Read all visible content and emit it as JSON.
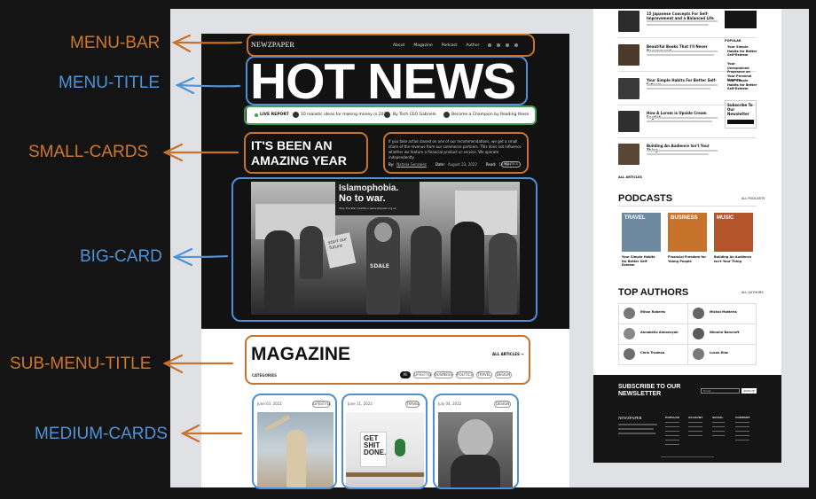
{
  "annotations": {
    "menu_bar": "MENU-BAR",
    "menu_title": "MENU-TITLE",
    "small_cards": "SMALL-CARDS",
    "big_card": "BIG-CARD",
    "sub_menu_title": "SUB-MENU-TITLE",
    "medium_cards": "MEDIUM-CARDS"
  },
  "colors": {
    "orange": "#c8732c",
    "blue": "#4f8fd6",
    "green": "#3fa04d"
  },
  "header": {
    "logo": "NEWZPAPER",
    "nav": [
      "About",
      "Magazine",
      "Podcast",
      "Author"
    ],
    "social_icons": [
      "facebook-icon",
      "twitter-icon",
      "instagram-icon",
      "youtube-icon"
    ]
  },
  "hero": {
    "title": "HOT NEWS",
    "ticker": {
      "live": "LIVE REPORT",
      "items": [
        "10 realistic ideas for making money in 2022",
        "By Tech CEO Gabriele",
        "Become a Champion by Reading these"
      ]
    },
    "card_title": "IT'S BEEN AN AMAZING YEAR",
    "card_desc": "If you take action based on one of our recommendations, we get a small share of the revenue from our commerce partners. This does not influence whether we feature a financial product or service. We operate independently.",
    "meta": {
      "by_label": "By:",
      "author": "Natalia Gonzalez",
      "date_label": "Date:",
      "date": "August 23, 2022",
      "read_label": "Read:",
      "read": "10 Min",
      "tag": "POLITICS"
    },
    "sign_line1": "Islamophobia.",
    "sign_line2": "No to war.",
    "sign_small": "Stop the War Coalition  www.stopwar.org.uk",
    "hoodie": "SDALE",
    "placard": "start our future"
  },
  "magazine": {
    "title": "MAGAZINE",
    "all_articles": "ALL ARTICLES",
    "categories_label": "CATEGORIES",
    "filters": [
      "All",
      "LIFESTYLE",
      "BUSINESS",
      "POLITICS",
      "TRAVEL",
      "DESIGN"
    ],
    "cards": [
      {
        "date": "June 03, 2022",
        "tag": "LIFESTYLE"
      },
      {
        "date": "June 11, 2022",
        "tag": "TRAVEL"
      },
      {
        "date": "July 04, 2022",
        "tag": "DESIGN"
      }
    ],
    "poster_text": "GET SHIT DONE."
  },
  "sidebar": {
    "articles": [
      {
        "title": "15 Japanese Concepts For Self-Improvement and a Balanced Life"
      },
      {
        "title": "Beautiful Books That I'll Never Recommend"
      },
      {
        "title": "Your Simple Habits For Better Self-Esteem"
      },
      {
        "title": "How A Lorem is Upside Cream English"
      },
      {
        "title": "Building An Audience Isn't Your Thing"
      }
    ],
    "popular_label": "POPULAR",
    "popular": [
      "Your Simple Habits for Better Self-Esteem",
      "Your Unexplained Fragrance on Your Personal Journey",
      "Your Simple Habits for Better Self-Esteem"
    ],
    "subscribe_box": "Subscribe To Our Newsletter",
    "all_articles": "ALL ARTICLES",
    "podcasts_title": "PODCASTS",
    "all_podcasts": "ALL PODCASTS",
    "podcasts": [
      {
        "label": "TRAVEL",
        "title": "Your Simple Habits for Better Self-Esteem",
        "color": "#6f8aa0"
      },
      {
        "label": "BUSINESS",
        "title": "Financial Freedom for Young People",
        "color": "#c8732c"
      },
      {
        "label": "MUSIC",
        "title": "Building An Audience Isn't Your Thing",
        "color": "#b3542b"
      }
    ],
    "authors_title": "TOP AUTHORS",
    "all_authors": "ALL AUTHORS",
    "authors": [
      "Ethan Roberts",
      "Michal Matteria",
      "Annabella Almonsyah",
      "Nimuhn Bancroft",
      "Chris Trudeau",
      "Lucas Diaz"
    ],
    "newsletter_title": "SUBSCRIBE TO OUR NEWSLETTER",
    "newsletter_placeholder": "Email",
    "newsletter_button": "SIGN UP",
    "footer_logo": "NEWZPAPER",
    "footer_cols": [
      "POPULAR",
      "ACCOUNT",
      "SOCIAL",
      "COMPANY"
    ]
  }
}
